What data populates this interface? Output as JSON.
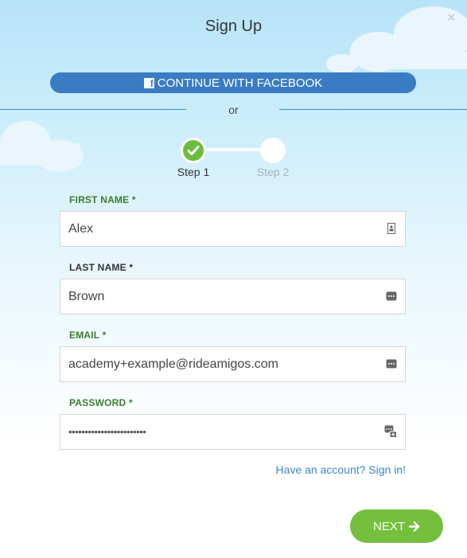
{
  "dialog": {
    "title": "Sign Up",
    "close_glyph": "×"
  },
  "facebook": {
    "label": "CONTINUE WITH FACEBOOK",
    "icon": "facebook-icon",
    "icon_glyph": "f",
    "color": "#3a7cc4"
  },
  "divider": {
    "label": "or"
  },
  "steps": [
    {
      "label": "Step 1",
      "status": "complete",
      "icon": "check-icon"
    },
    {
      "label": "Step 2",
      "status": "pending"
    }
  ],
  "form": {
    "first_name": {
      "label": "FIRST NAME *",
      "value": "Alex",
      "icon": "contact-card-icon"
    },
    "last_name": {
      "label": "LAST NAME *",
      "value": "Brown",
      "icon": "password-manager-icon"
    },
    "email": {
      "label": "EMAIL *",
      "value": "academy+example@rideamigos.com",
      "icon": "password-manager-icon"
    },
    "password": {
      "label": "PASSWORD *",
      "value": "••••••••••••••••••••••••",
      "icon": "password-generator-icon"
    }
  },
  "signin_link": "Have an account? Sign in!",
  "next_button": {
    "label": "NEXT",
    "icon": "arrow-right-icon"
  },
  "colors": {
    "accent_green": "#74bf3c",
    "label_green": "#3a7d2c",
    "label_dark": "#333333",
    "link_blue": "#3b87c9"
  }
}
